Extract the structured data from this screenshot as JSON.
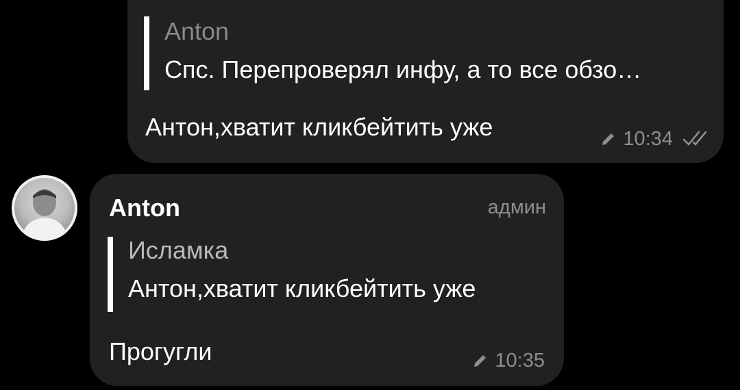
{
  "colors": {
    "background": "#000000",
    "bubble": "#212121",
    "text": "#ffffff",
    "muted": "#8e8e8e",
    "reply_bar": "#ffffff"
  },
  "messages": [
    {
      "direction": "outgoing",
      "reply": {
        "name": "Anton",
        "text": "Спс. Перепроверял инфу, а то все обзо…"
      },
      "text": "Антон,хватит кликбейтить уже",
      "edited_icon": "pencil-icon",
      "time": "10:34",
      "status_icon": "double-check-icon"
    },
    {
      "direction": "incoming",
      "sender": "Anton",
      "role": "админ",
      "avatar_icon": "avatar-photo",
      "reply": {
        "name": "Исламка",
        "text": "Антон,хватит кликбейтить уже"
      },
      "text": "Прогугли",
      "edited_icon": "pencil-icon",
      "time": "10:35"
    }
  ]
}
